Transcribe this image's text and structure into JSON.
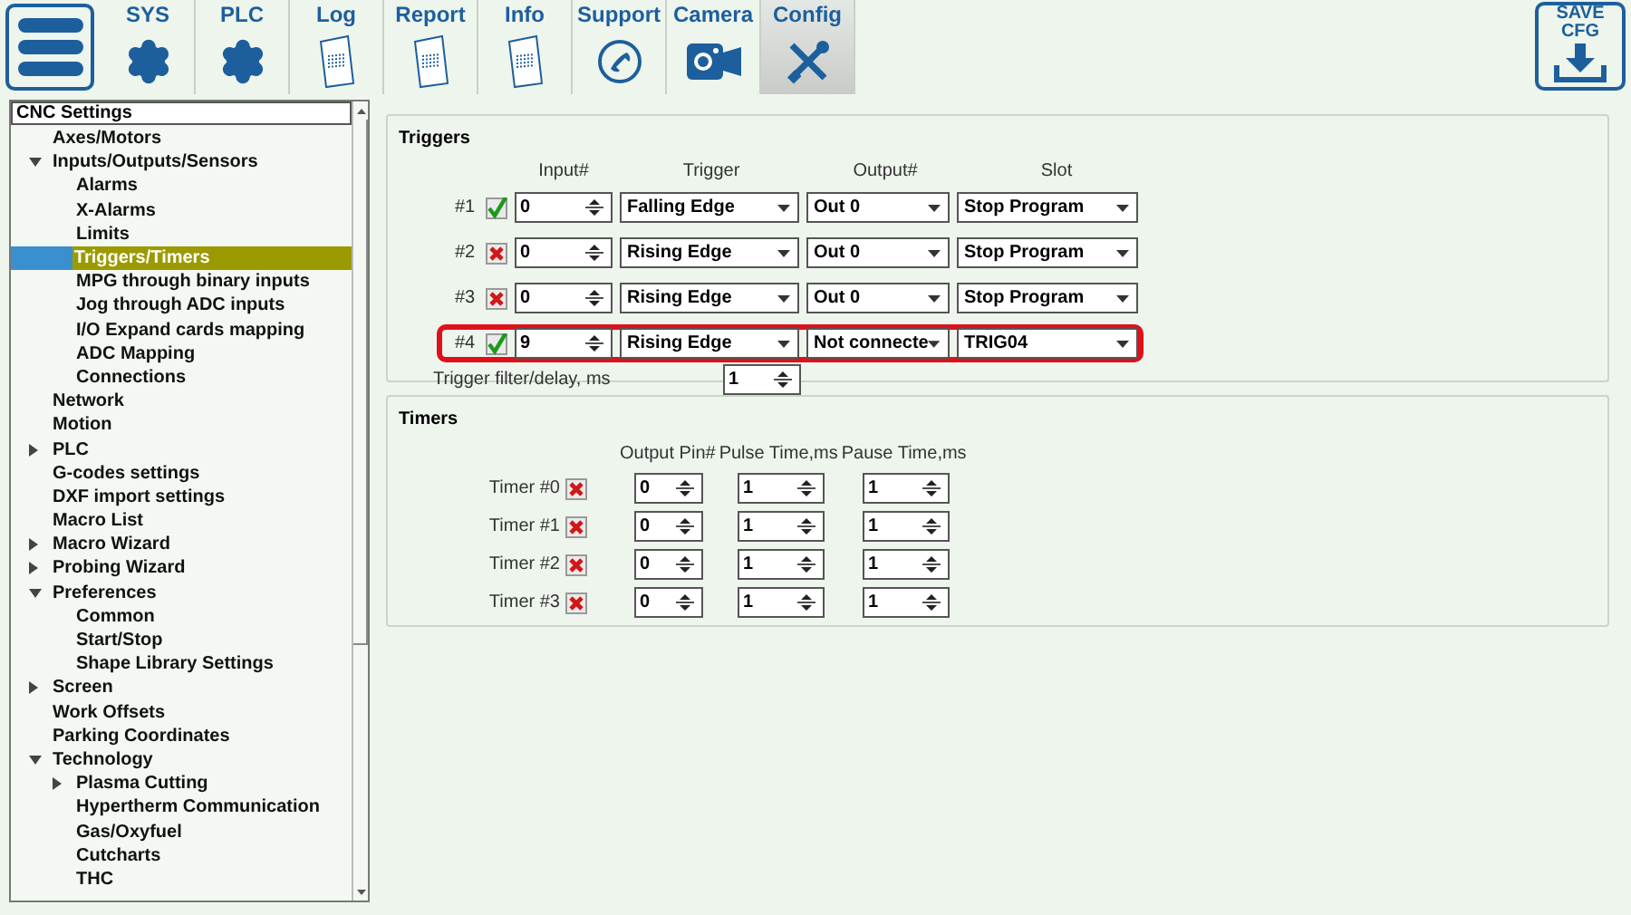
{
  "toolbar": {
    "tabs": [
      {
        "label": "SYS",
        "kind": "gear",
        "selected": false
      },
      {
        "label": "PLC",
        "kind": "gear",
        "selected": false
      },
      {
        "label": "Log",
        "kind": "doc",
        "selected": false
      },
      {
        "label": "Report",
        "kind": "doc",
        "selected": false
      },
      {
        "label": "Info",
        "kind": "doc",
        "selected": false
      },
      {
        "label": "Support",
        "kind": "phone",
        "selected": false
      },
      {
        "label": "Camera",
        "kind": "camera",
        "selected": false
      },
      {
        "label": "Config",
        "kind": "tools",
        "selected": true
      }
    ],
    "save_button": {
      "lines": [
        "SAVE",
        "CFG"
      ]
    }
  },
  "tree": {
    "title": "CNC Settings",
    "items": [
      {
        "label": "Axes/Motors",
        "selected": false
      },
      {
        "label": "Inputs/Outputs/Sensors",
        "selected": false,
        "expanded": true,
        "children": [
          {
            "label": "Alarms",
            "selected": false
          },
          {
            "label": "X-Alarms",
            "selected": false
          },
          {
            "label": "Limits",
            "selected": false
          },
          {
            "label": "Triggers/Timers",
            "selected": true
          },
          {
            "label": "MPG through binary inputs",
            "selected": false
          },
          {
            "label": "Jog through ADC inputs",
            "selected": false
          },
          {
            "label": "I/O Expand cards mapping",
            "selected": false
          },
          {
            "label": "ADC Mapping",
            "selected": false
          },
          {
            "label": "Connections",
            "selected": false
          }
        ]
      },
      {
        "label": "Network",
        "selected": false
      },
      {
        "label": "Motion",
        "selected": false
      },
      {
        "label": "PLC",
        "selected": false,
        "expanded": false
      },
      {
        "label": "G-codes settings",
        "selected": false
      },
      {
        "label": "DXF import settings",
        "selected": false
      },
      {
        "label": "Macro List",
        "selected": false
      },
      {
        "label": "Macro Wizard",
        "selected": false,
        "expanded": false
      },
      {
        "label": "Probing Wizard",
        "selected": false,
        "expanded": false
      },
      {
        "label": "Preferences",
        "selected": false,
        "expanded": true,
        "children": [
          {
            "label": "Common",
            "selected": false
          },
          {
            "label": "Start/Stop",
            "selected": false
          },
          {
            "label": "Shape Library Settings",
            "selected": false
          }
        ]
      },
      {
        "label": "Screen",
        "selected": false,
        "expanded": false
      },
      {
        "label": "Work Offsets",
        "selected": false
      },
      {
        "label": "Parking Coordinates",
        "selected": false
      },
      {
        "label": "Technology",
        "selected": false,
        "expanded": true,
        "children": [
          {
            "label": "Plasma Cutting",
            "selected": false,
            "expanded": false
          },
          {
            "label": "Hypertherm Communication",
            "selected": false
          },
          {
            "label": "Gas/Oxyfuel",
            "selected": false
          },
          {
            "label": "Cutcharts",
            "selected": false
          },
          {
            "label": "THC",
            "selected": false
          }
        ]
      }
    ]
  },
  "triggers": {
    "title": "Triggers",
    "columns": [
      "Input#",
      "Trigger",
      "Output#",
      "Slot"
    ],
    "rows": [
      {
        "label": "#1",
        "checked": true,
        "highlighted": false,
        "input": "0",
        "trigger": "Falling Edge",
        "output": "Out 0",
        "slot": "Stop Program"
      },
      {
        "label": "#2",
        "checked": false,
        "highlighted": false,
        "input": "0",
        "trigger": "Rising Edge",
        "output": "Out 0",
        "slot": "Stop Program"
      },
      {
        "label": "#3",
        "checked": false,
        "highlighted": false,
        "input": "0",
        "trigger": "Rising Edge",
        "output": "Out 0",
        "slot": "Stop Program"
      },
      {
        "label": "#4",
        "checked": true,
        "highlighted": true,
        "input": "9",
        "trigger": "Rising Edge",
        "output": "Not connecte",
        "slot": "TRIG04"
      }
    ],
    "filter": {
      "label": "Trigger filter/delay, ms",
      "value": "1"
    }
  },
  "timers": {
    "title": "Timers",
    "columns": [
      "Output Pin#",
      "Pulse Time,ms",
      "Pause Time,ms"
    ],
    "rows": [
      {
        "label": "Timer #0",
        "checked": false,
        "output_pin": "0",
        "pulse_time": "1",
        "pause_time": "1"
      },
      {
        "label": "Timer #1",
        "checked": false,
        "output_pin": "0",
        "pulse_time": "1",
        "pause_time": "1"
      },
      {
        "label": "Timer #2",
        "checked": false,
        "output_pin": "0",
        "pulse_time": "1",
        "pause_time": "1"
      },
      {
        "label": "Timer #3",
        "checked": false,
        "output_pin": "0",
        "pulse_time": "1",
        "pause_time": "1"
      }
    ]
  }
}
